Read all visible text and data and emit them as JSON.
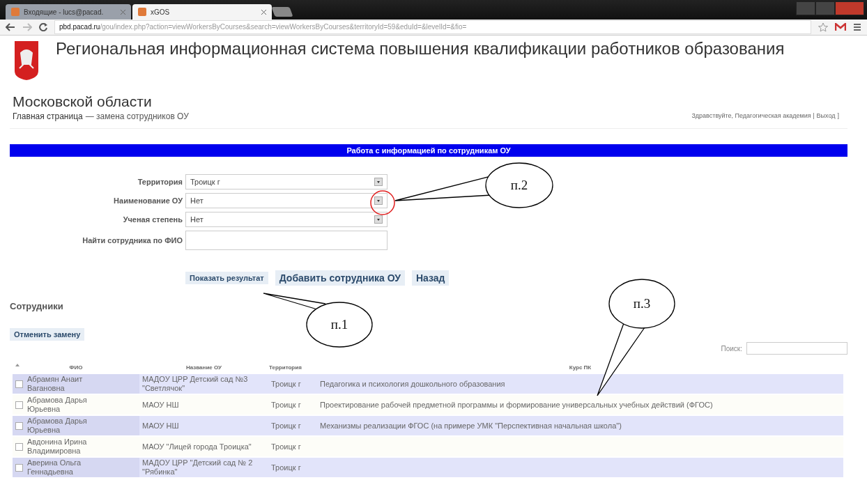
{
  "browser": {
    "tabs": [
      {
        "title": "Входящие - lucs@pacad.",
        "selected": false
      },
      {
        "title": "xGOS",
        "selected": true
      }
    ],
    "url_host": "pbd.pacad.ru",
    "url_path": "/gou/index.php?action=viewWorkersByCourses&search=viewWorkersByCourses&territoryId=59&eduId=&levelId=&fio="
  },
  "header": {
    "title": "Региональная информационная система повышения квалификации работников образования",
    "title_line2": "Московской области",
    "breadcrumb": [
      {
        "label": "Главная страница",
        "link": true
      },
      {
        "label": "— замена сотрудников ОУ",
        "link": false
      }
    ],
    "greeting": "Здравствуйте, Педагогическая академия |",
    "logout": "Выход",
    "logout_close": "]"
  },
  "banner": "Работа с информацией по сотрудникам ОУ",
  "form": {
    "fields": [
      {
        "kind": "select",
        "label": "Территория",
        "value": "Троицк г"
      },
      {
        "kind": "select",
        "label": "Наименование ОУ",
        "value": "Нет"
      },
      {
        "kind": "select",
        "label": "Ученая степень",
        "value": "Нет"
      },
      {
        "kind": "text",
        "label": "Найти сотрудника по ФИО"
      }
    ],
    "buttons": [
      "Показать результат",
      "Добавить сотрудника ОУ",
      "Назад"
    ]
  },
  "section_title": "Сотрудники",
  "cancel_button": "Отменить замену",
  "search_label": "Поиск:",
  "table": {
    "columns": [
      "ФИО",
      "Название ОУ",
      "Территория",
      "Курс ПК"
    ],
    "rows": [
      {
        "checked": false,
        "cells": [
          "Абрамян Анаит Вагановна",
          "МАДОУ ЦРР Детский сад №3 \"Светлячок\"",
          "Троицк г",
          "Педагогика и психология дошкольного образования"
        ]
      },
      {
        "checked": false,
        "cells": [
          "Абрамова Дарья Юрьевна",
          "МАОУ НШ",
          "Троицк г",
          "Проектирование рабочей предметной программы и формирование универсальных учебных действий (ФГОС)"
        ]
      },
      {
        "checked": false,
        "cells": [
          "Абрамова Дарья Юрьевна",
          "МАОУ НШ",
          "Троицк г",
          "Механизмы реализации ФГОС (на примере УМК \"Перспективная начальная школа\")"
        ]
      },
      {
        "checked": false,
        "cells": [
          "Авдонина Ирина Владимировна",
          "МАОУ \"Лицей города Троицка\"",
          "Троицк г"
        ]
      },
      {
        "checked": false,
        "cells": [
          "Аверина Ольга Геннадьевна",
          "МАДОУ ЦРР \"Детский сад № 2 \"Рябинка\"",
          "Троицк г"
        ]
      }
    ]
  },
  "callouts": [
    "п.1",
    "п.2",
    "п.3"
  ]
}
